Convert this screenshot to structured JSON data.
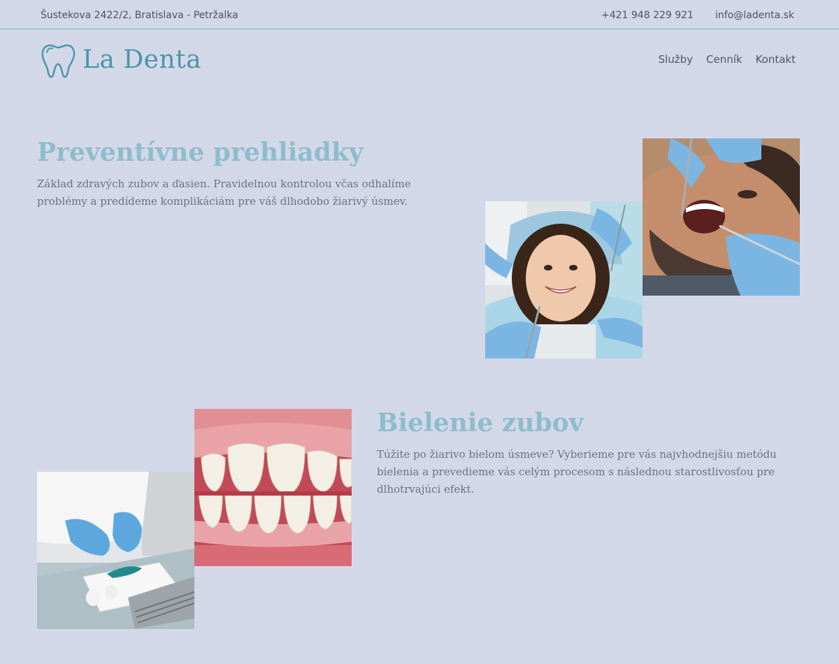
{
  "topbar": {
    "address": "Šustekova 2422/2, Bratislava - Petržalka",
    "phone": "+421 948 229 921",
    "email": "info@ladenta.sk"
  },
  "header": {
    "logo_text": "La Denta",
    "logo_icon": "tooth-icon",
    "nav": [
      {
        "label": "Služby"
      },
      {
        "label": "Cenník"
      },
      {
        "label": "Kontakt"
      }
    ]
  },
  "sections": [
    {
      "title": "Preventívne prehliadky",
      "text": "Základ zdravých zubov a ďasien. Pravidelnou kontrolou včas odhalíme problémy a predídeme komplikáciám pre váš dlhodobo žiarivý úsmev."
    },
    {
      "title": "Bielenie zubov",
      "text": "Túžite po žiarivo bielom úsmeve? Vyberieme pre vás najvhodnejšiu metódu bielenia a prevedieme vás celým procesom s následnou starostlivosťou pre dlhotrvajúci efekt."
    }
  ],
  "colors": {
    "background": "#d3d8e8",
    "accent": "#4b95aa",
    "heading": "#8ebccd",
    "divider": "#79b1c2"
  }
}
